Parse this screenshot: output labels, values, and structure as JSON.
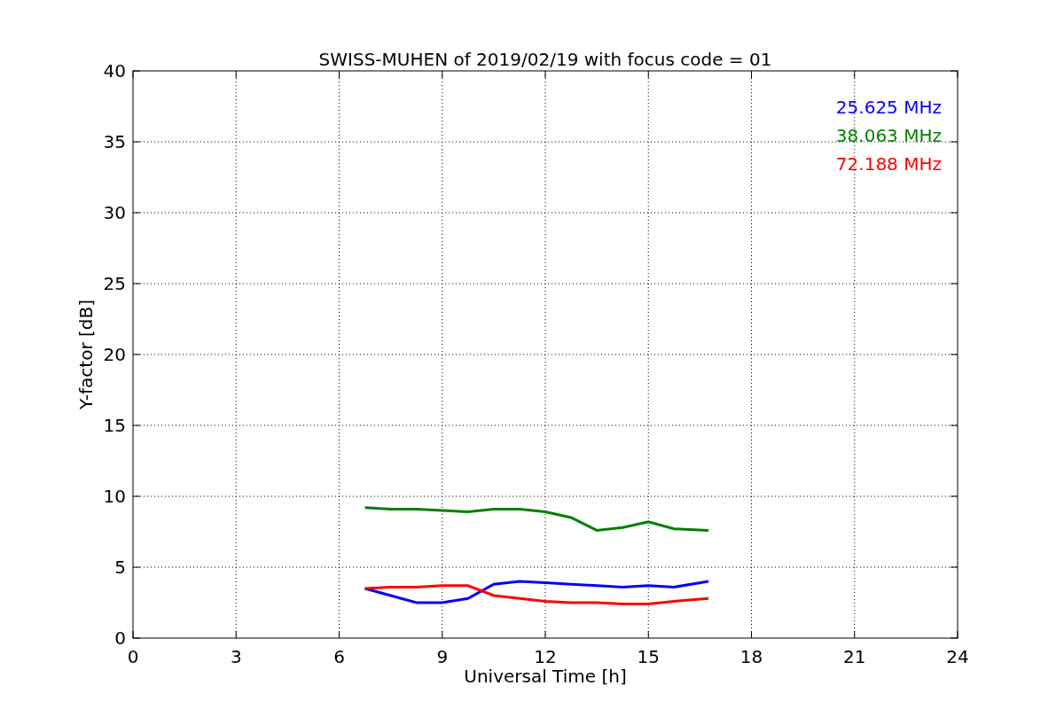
{
  "chart_data": {
    "type": "line",
    "title": "SWISS-MUHEN of 2019/02/19 with focus code = 01",
    "xlabel": "Universal Time [h]",
    "ylabel": "Y-factor [dB]",
    "x": [
      6.75,
      7.5,
      8.25,
      9,
      9.75,
      10.5,
      11.25,
      12,
      12.75,
      13.5,
      14.25,
      15,
      15.75,
      16.75
    ],
    "series": [
      {
        "name": "25.625 MHz",
        "color": "#0000ff",
        "values": [
          3.5,
          3.0,
          2.5,
          2.5,
          2.8,
          3.8,
          4.0,
          3.9,
          3.8,
          3.7,
          3.6,
          3.7,
          3.6,
          4.0
        ]
      },
      {
        "name": "38.063 MHz",
        "color": "#008000",
        "values": [
          9.2,
          9.1,
          9.1,
          9.0,
          8.9,
          9.1,
          9.1,
          8.9,
          8.5,
          7.6,
          7.8,
          8.2,
          7.7,
          7.6
        ]
      },
      {
        "name": "72.188 MHz",
        "color": "#ff0000",
        "values": [
          3.5,
          3.6,
          3.6,
          3.7,
          3.7,
          3.0,
          2.8,
          2.6,
          2.5,
          2.5,
          2.4,
          2.4,
          2.6,
          2.8
        ]
      }
    ],
    "xlim": [
      0,
      24
    ],
    "ylim": [
      0,
      40
    ],
    "xticks": [
      0,
      3,
      6,
      9,
      12,
      15,
      18,
      21,
      24
    ],
    "yticks": [
      0,
      5,
      10,
      15,
      20,
      25,
      30,
      35,
      40
    ],
    "grid": true
  }
}
